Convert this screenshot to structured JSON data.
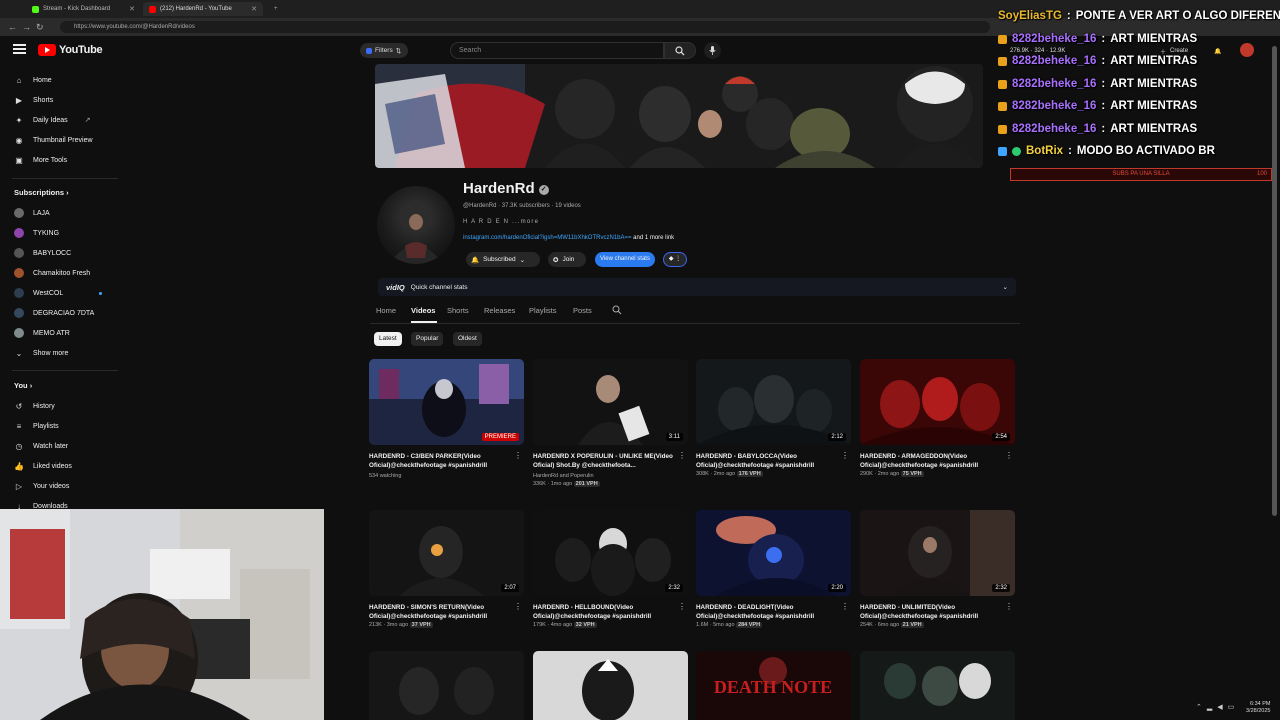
{
  "browser": {
    "tabs": [
      {
        "label": "Stream - Kick Dashboard"
      },
      {
        "label": "(212) HardenRd - YouTube"
      }
    ],
    "url": "https://www.youtube.com/@HardenRd/videos"
  },
  "header": {
    "logo_text": "YouTube",
    "filters_label": "Filters",
    "search_placeholder": "Search",
    "create_label": "Create",
    "stats_line": "276.9K · 324 · 12.9K"
  },
  "sidebar": {
    "main": [
      {
        "label": "Home",
        "icon": "home-icon"
      },
      {
        "label": "Shorts",
        "icon": "shorts-icon"
      },
      {
        "label": "Daily Ideas",
        "icon": "lightbulb-icon"
      },
      {
        "label": "Thumbnail Preview",
        "icon": "preview-icon"
      },
      {
        "label": "More Tools",
        "icon": "tools-icon"
      }
    ],
    "subscriptions_title": "Subscriptions",
    "subscriptions": [
      {
        "label": "LAJA",
        "color": "#6a6a6a"
      },
      {
        "label": "TYKING",
        "color": "#8e44ad"
      },
      {
        "label": "BABYLOCC",
        "color": "#555555"
      },
      {
        "label": "Chamakitoo Fresh",
        "color": "#a0522d"
      },
      {
        "label": "WestCOL",
        "color": "#2c3e50"
      },
      {
        "label": "DEGRACIAO 7DTA",
        "color": "#34495e"
      },
      {
        "label": "MEMO ATR",
        "color": "#7f8c8d"
      },
      {
        "label": "Show more",
        "icon": "chevron-down-icon"
      }
    ],
    "you_title": "You",
    "you": [
      {
        "label": "History",
        "icon": "history-icon"
      },
      {
        "label": "Playlists",
        "icon": "playlist-icon"
      },
      {
        "label": "Watch later",
        "icon": "clock-icon"
      },
      {
        "label": "Liked videos",
        "icon": "thumbs-up-icon"
      },
      {
        "label": "Your videos",
        "icon": "video-icon"
      },
      {
        "label": "Downloads",
        "icon": "download-icon"
      }
    ]
  },
  "channel": {
    "name": "HardenRd",
    "meta": "@HardenRd · 37.3K subscribers · 19 videos",
    "description": "H A R D E N ...more",
    "link": "instagram.com/hardenOficial?igsh=MW11bXhkOTRvczN1bA==",
    "more_links": "and 1 more link",
    "subscribed_label": "Subscribed",
    "join_label": "Join",
    "stats_label": "View channel stats",
    "vidiq_quick": "Quick channel stats",
    "vidiq_logo": "vidIQ"
  },
  "tabs": [
    "Home",
    "Videos",
    "Shorts",
    "Releases",
    "Playlists",
    "Posts"
  ],
  "chips": [
    "Latest",
    "Popular",
    "Oldest"
  ],
  "videos": [
    {
      "title": "HARDENRD - C3/BEN PARKER(Video Oficial)@checkthefootage #spanishdrill",
      "meta": "534 watching",
      "vph": "",
      "duration": "PREMIERE"
    },
    {
      "title": "HARDENRD X POPERULIN - UNLIKE ME(Video Oficial) Shot.By @checkthefoota...",
      "meta": "HardenRd and Poperulin",
      "meta2": "336K · 1mo ago",
      "vph": "201 VPH",
      "duration": "3:11"
    },
    {
      "title": "HARDENRD - BABYLOCCA(Video Oficial)@checkthefootage #spanishdrill",
      "meta": "308K · 2mo ago",
      "vph": "176 VPH",
      "duration": "2:12"
    },
    {
      "title": "HARDENRD - ARMAGEDDON(Video Oficial)@checkthefootage #spanishdrill",
      "meta": "290K · 2mo ago",
      "vph": "75 VPH",
      "duration": "2:54"
    },
    {
      "title": "HARDENRD - SIMON'S RETURN(Video Oficial)@checkthefootage #spanishdrill",
      "meta": "213K · 3mo ago",
      "vph": "37 VPH",
      "duration": "2:07"
    },
    {
      "title": "HARDENRD - HELLBOUND(Video Oficial)@checkthefootage #spanishdrill",
      "meta": "179K · 4mo ago",
      "vph": "32 VPH",
      "duration": "2:32"
    },
    {
      "title": "HARDENRD - DEADLIGHT(Video Oficial)@checkthefootage #spanishdrill",
      "meta": "1.6M · 5mo ago",
      "vph": "284 VPH",
      "duration": "2:20"
    },
    {
      "title": "HARDENRD - UNLIMITED(Video Oficial)@checkthefootage #spanishdrill",
      "meta": "254K · 6mo ago",
      "vph": "21 VPH",
      "duration": "2:32"
    },
    {
      "title": "",
      "meta": "",
      "vph": "",
      "duration": ""
    },
    {
      "title": "",
      "meta": "",
      "vph": "",
      "duration": ""
    },
    {
      "title": "",
      "meta": "",
      "vph": "",
      "duration": "",
      "overlay": "DEATH NOTE"
    },
    {
      "title": "",
      "meta": "",
      "vph": "",
      "duration": ""
    }
  ],
  "chat": [
    {
      "user": "SoyEliasTG",
      "text": "PONTE A VER ART O ALGO DIFERENTE"
    },
    {
      "user": "8282beheke_16",
      "text": "ART MIENTRAS"
    },
    {
      "user": "8282beheke_16",
      "text": "ART MIENTRAS"
    },
    {
      "user": "8282beheke_16",
      "text": "ART MIENTRAS"
    },
    {
      "user": "8282beheke_16",
      "text": "ART MIENTRAS"
    },
    {
      "user": "8282beheke_16",
      "text": "ART MIENTRAS"
    },
    {
      "user": "BotRix",
      "text": "MODO BO ACTIVADO BR"
    }
  ],
  "sub_goal": {
    "label": "SUBS PA UNA SILLA",
    "value": "100"
  },
  "clock": {
    "time": "6:34 PM",
    "date": "3/28/2025"
  },
  "colors": {
    "accent": "#ff0000",
    "link": "#3ea6ff",
    "vidiq": "#2b7bf0",
    "chat_user": "#a970ff"
  }
}
